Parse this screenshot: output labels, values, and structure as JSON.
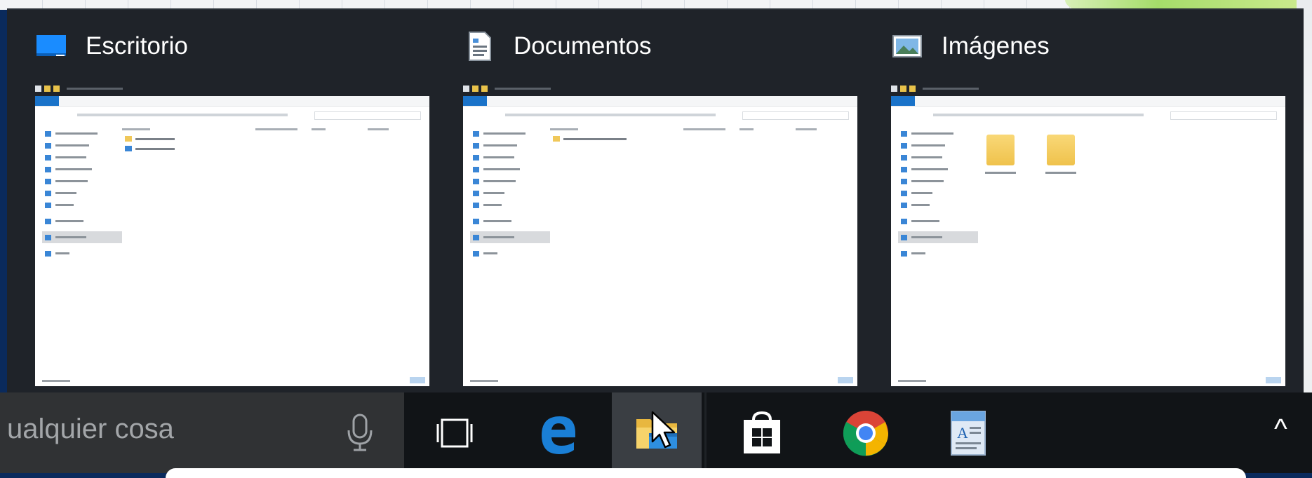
{
  "previews": [
    {
      "id": "desktop",
      "title": "Escritorio",
      "icon": "desktop-icon",
      "kind": "files"
    },
    {
      "id": "documents",
      "title": "Documentos",
      "icon": "documents-icon",
      "kind": "folder-row"
    },
    {
      "id": "pictures",
      "title": "Imágenes",
      "icon": "pictures-icon",
      "kind": "big-folders"
    }
  ],
  "taskbar": {
    "search_text": "ualquier cosa",
    "buttons": [
      "task-view-icon",
      "edge-icon",
      "file-explorer-icon",
      "store-icon",
      "chrome-icon",
      "wordpad-icon"
    ],
    "active": "file-explorer-icon",
    "overflow_glyph": "^"
  },
  "colors": {
    "flyout_bg": "#1f2329",
    "taskbar_bg": "#111417",
    "search_bg": "#303234",
    "accent": "#1a73c9"
  }
}
